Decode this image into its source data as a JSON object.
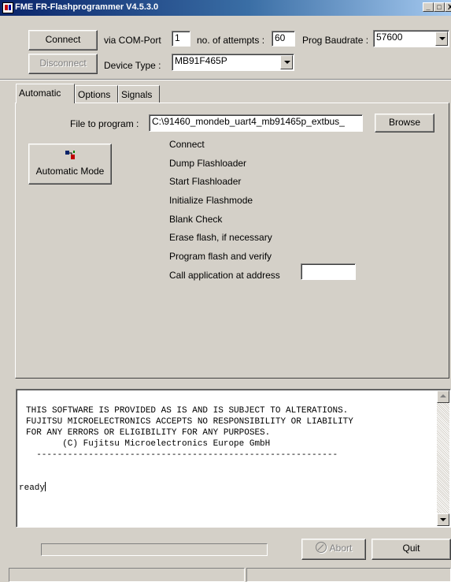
{
  "window": {
    "title": "FME FR-Flashprogrammer V4.5.3.0",
    "minimize_glyph": "_",
    "maximize_glyph": "□",
    "close_glyph": "X"
  },
  "connection": {
    "connect_label": "Connect",
    "via_com_port_label": "via COM-Port",
    "com_port_value": "1",
    "attempts_label": "no. of attempts :",
    "attempts_value": "60",
    "baudrate_label": "Prog Baudrate :",
    "baudrate_value": "57600",
    "disconnect_label": "Disconnect",
    "device_type_label": "Device Type :",
    "device_type_value": "MB91F465P"
  },
  "tabs": [
    {
      "label": "Automatic",
      "active": true
    },
    {
      "label": "Options",
      "active": false
    },
    {
      "label": "Signals",
      "active": false
    }
  ],
  "automatic": {
    "file_label": "File to program :",
    "file_value": "C:\\91460_mondeb_uart4_mb91465p_extbus_",
    "browse_label": "Browse",
    "auto_mode_label": "Automatic Mode",
    "auto_mode_icon": "flash-program-icon",
    "steps": [
      "Connect",
      "Dump Flashloader",
      "Start Flashloader",
      "Initialize Flashmode",
      "Blank Check",
      "Erase flash, if necessary",
      "Program flash and verify",
      "Call application at address"
    ],
    "call_address_value": ""
  },
  "log": {
    "lines": [
      "THIS SOFTWARE IS PROVIDED AS IS AND IS SUBJECT TO ALTERATIONS.",
      "FUJITSU MICROELECTRONICS ACCEPTS NO RESPONSIBILITY OR LIABILITY",
      "FOR ANY ERRORS OR ELIGIBILITY FOR ANY PURPOSES.",
      "       (C) Fujitsu Microelectronics Europe GmbH",
      "  ----------------------------------------------------------"
    ],
    "status_text": "ready"
  },
  "footer": {
    "progress": 0,
    "abort_label": "Abort",
    "abort_icon": "abort-icon",
    "quit_label": "Quit"
  },
  "colors": {
    "face": "#d4d0c8",
    "title_active": "#0a246a"
  }
}
